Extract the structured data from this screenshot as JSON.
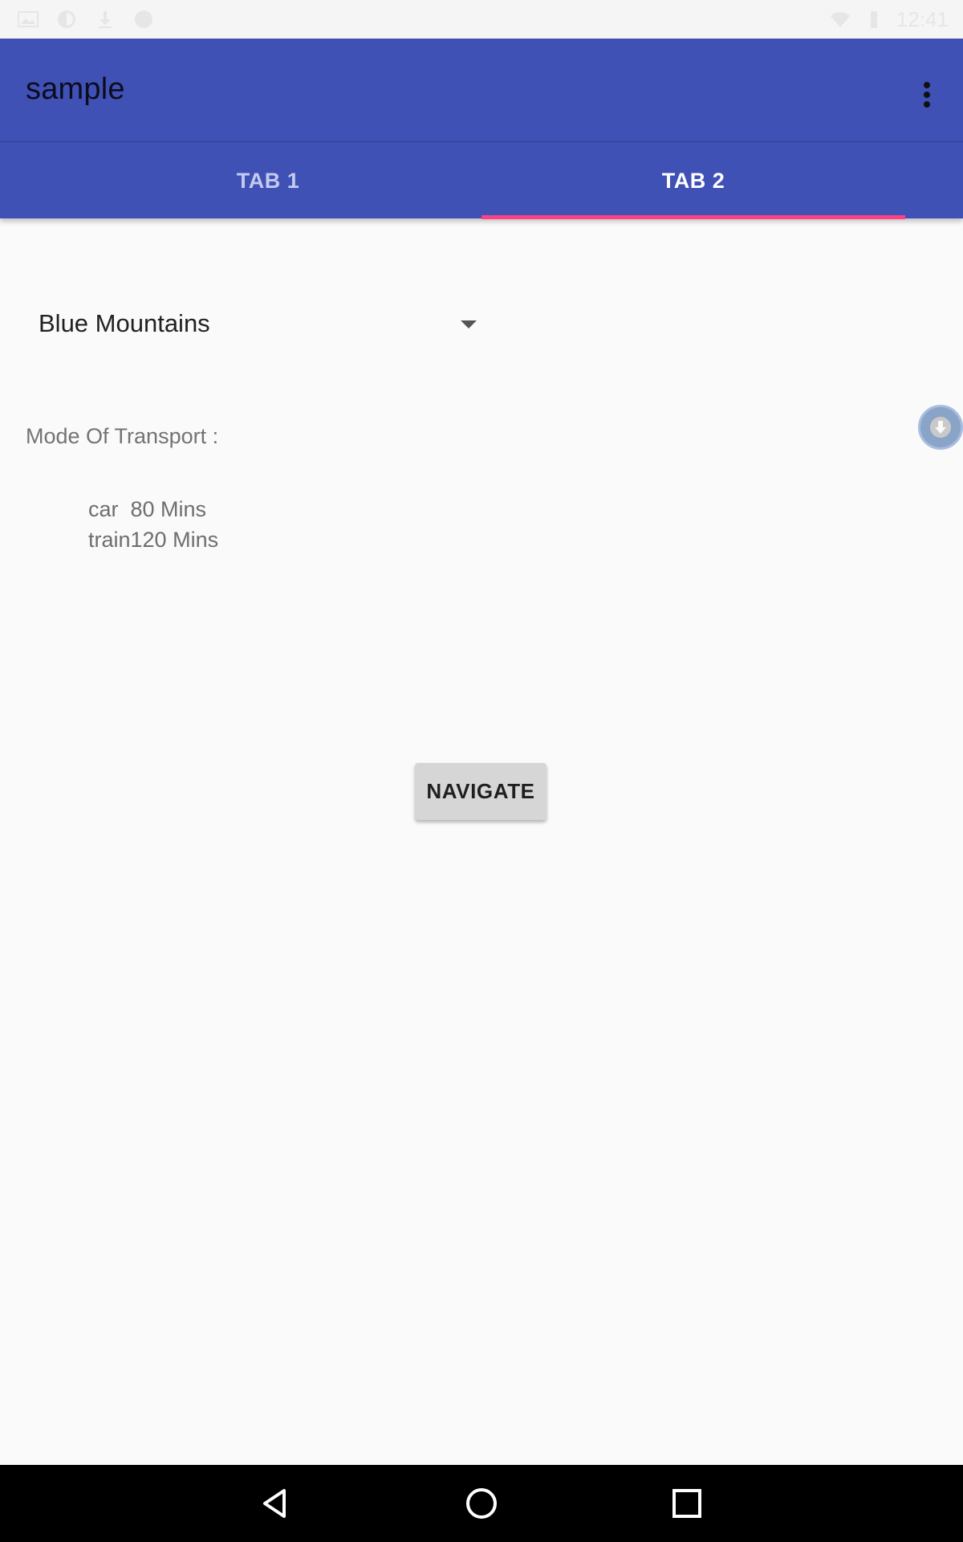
{
  "status_bar": {
    "time": "12:41",
    "icons": [
      "image-icon",
      "sync-icon",
      "download-icon",
      "circle-icon",
      "wifi-icon",
      "battery-icon"
    ]
  },
  "app_bar": {
    "title": "sample",
    "overflow_icon": "more-vert-icon"
  },
  "tabs": [
    {
      "label": "TAB 1",
      "selected": false
    },
    {
      "label": "TAB 2",
      "selected": true
    }
  ],
  "colors": {
    "primary": "#3f51b5",
    "accent": "#ff4081",
    "background": "#fafafa"
  },
  "spinner": {
    "selected_value": "Blue Mountains"
  },
  "transport": {
    "label": "Mode Of Transport :",
    "items": [
      "car  80 Mins",
      "train120 Mins"
    ],
    "side_button_icon": "download-arrow-icon"
  },
  "navigate_button": {
    "label": "NAVIGATE"
  },
  "nav_bar": {
    "icons": [
      "back-icon",
      "home-icon",
      "recents-icon"
    ]
  }
}
